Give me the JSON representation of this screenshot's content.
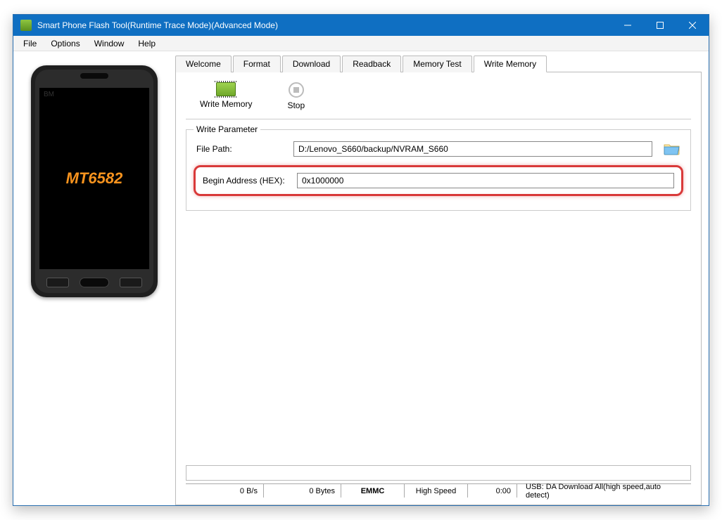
{
  "window": {
    "title": "Smart Phone Flash Tool(Runtime Trace Mode)(Advanced Mode)"
  },
  "menu": {
    "file": "File",
    "options": "Options",
    "window": "Window",
    "help": "Help"
  },
  "phone": {
    "bm": "BM",
    "chipset": "MT6582"
  },
  "tabs": {
    "welcome": "Welcome",
    "format": "Format",
    "download": "Download",
    "readback": "Readback",
    "memory_test": "Memory Test",
    "write_memory": "Write Memory"
  },
  "toolbar": {
    "write_memory": "Write Memory",
    "stop": "Stop"
  },
  "fieldset": {
    "legend": "Write Parameter",
    "file_path_label": "File Path:",
    "file_path_value": "D:/Lenovo_S660/backup/NVRAM_S660",
    "begin_addr_label": "Begin Address (HEX):",
    "begin_addr_value": "0x1000000"
  },
  "status": {
    "rate": "0 B/s",
    "bytes": "0 Bytes",
    "storage": "EMMC",
    "speed": "High Speed",
    "time": "0:00",
    "usb": "USB: DA Download All(high speed,auto detect)"
  }
}
